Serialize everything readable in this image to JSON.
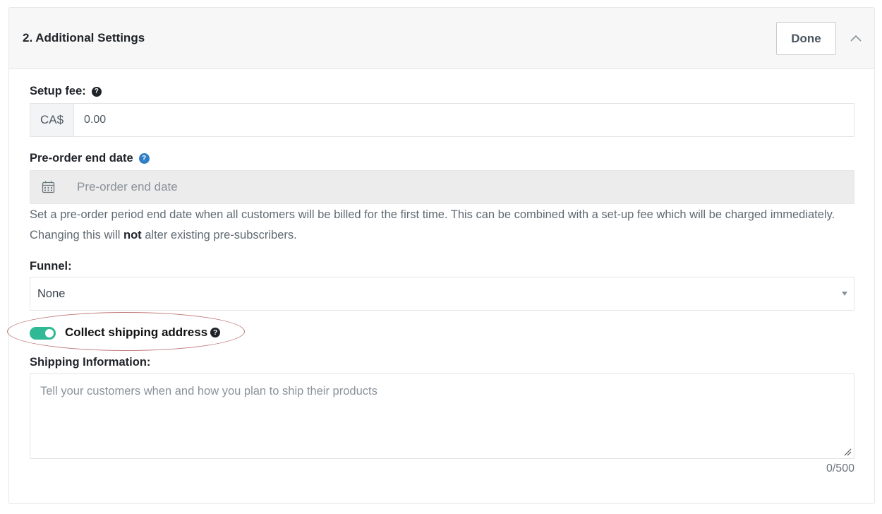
{
  "header": {
    "title": "2. Additional Settings",
    "done_label": "Done",
    "collapse_icon": "chevron-up-icon"
  },
  "setup_fee": {
    "label": "Setup fee:",
    "help_icon": "question-circle-icon",
    "currency_prefix": "CA$",
    "value": "0.00"
  },
  "preorder_end_date": {
    "label": "Pre-order end date",
    "help_icon": "question-circle-icon",
    "calendar_icon": "calendar-icon",
    "placeholder": "Pre-order end date",
    "help_text_before": "Set a pre-order period end date when all customers will be billed for the first time. This can be combined with a set-up fee which will be charged immediately. Changing this will ",
    "help_text_bold": "not",
    "help_text_after": " alter existing pre-subscribers."
  },
  "funnel": {
    "label": "Funnel:",
    "selected": "None"
  },
  "collect_shipping": {
    "label": "Collect shipping address",
    "enabled": true,
    "help_icon": "question-circle-icon"
  },
  "shipping_info": {
    "label": "Shipping Information:",
    "placeholder": "Tell your customers when and how you plan to ship their products",
    "counter": "0/500"
  },
  "colors": {
    "toggle_on": "#2fb995",
    "help_blue": "#2f7ec6",
    "annotation": "#c07a7a"
  }
}
